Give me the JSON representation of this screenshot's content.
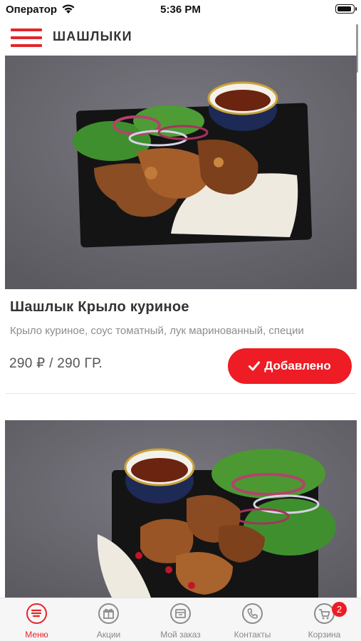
{
  "status_bar": {
    "carrier": "Оператор",
    "time": "5:36 PM",
    "battery_level": 0.85
  },
  "header": {
    "title": "ШАШЛЫКИ",
    "menu_icon": "hamburger-icon"
  },
  "products": [
    {
      "name": "Шашлык Крыло куриное",
      "description": "Крыло куриное, соус томатный, лук маринованный, специи",
      "price": "290 ₽ / 290 ГР.",
      "button_label": "Добавлено",
      "button_icon": "checkmark-icon"
    },
    {
      "name": "",
      "description": "",
      "price": "",
      "button_label": ""
    }
  ],
  "tab_bar": {
    "tabs": [
      {
        "label": "Меню",
        "icon": "menu-list-icon",
        "active": true
      },
      {
        "label": "Акции",
        "icon": "gift-icon",
        "active": false
      },
      {
        "label": "Мой заказ",
        "icon": "order-box-icon",
        "active": false
      },
      {
        "label": "Контакты",
        "icon": "phone-icon",
        "active": false
      },
      {
        "label": "Корзина",
        "icon": "cart-icon",
        "active": false,
        "badge": "2"
      }
    ]
  },
  "colors": {
    "accent": "#e3262b",
    "button": "#ee1c25",
    "photo_background": "#6d6b72"
  }
}
